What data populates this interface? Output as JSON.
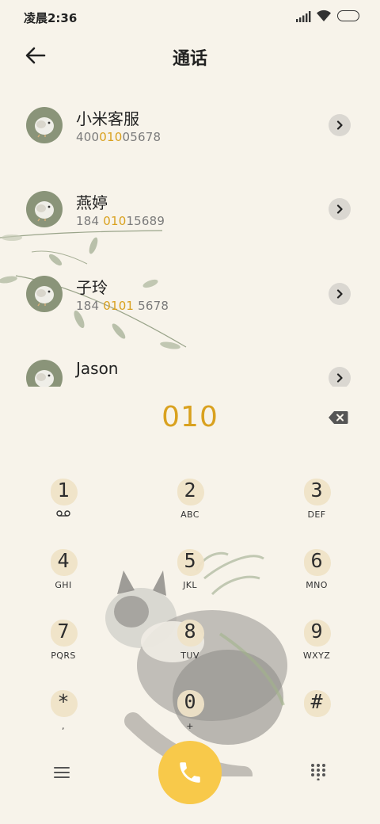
{
  "status": {
    "time": "凌晨2:36"
  },
  "header": {
    "title": "通话"
  },
  "contacts": [
    {
      "name": "小米客服",
      "num_pre": "400",
      "num_hl": "010",
      "num_post": "05678"
    },
    {
      "name": "燕婷",
      "num_pre": "184 ",
      "num_hl": "010",
      "num_post": "15689"
    },
    {
      "name": "子玲",
      "num_pre": "184 ",
      "num_hl": "0101",
      "num_post": " 5678"
    },
    {
      "name": "Jason",
      "num_pre": "",
      "num_hl": "",
      "num_post": ""
    }
  ],
  "input": {
    "digits": "010"
  },
  "keypad": [
    {
      "digit": "1",
      "sub": ""
    },
    {
      "digit": "2",
      "sub": "ABC"
    },
    {
      "digit": "3",
      "sub": "DEF"
    },
    {
      "digit": "4",
      "sub": "GHI"
    },
    {
      "digit": "5",
      "sub": "JKL"
    },
    {
      "digit": "6",
      "sub": "MNO"
    },
    {
      "digit": "7",
      "sub": "PQRS"
    },
    {
      "digit": "8",
      "sub": "TUV"
    },
    {
      "digit": "9",
      "sub": "WXYZ"
    },
    {
      "digit": "*",
      "sub": ","
    },
    {
      "digit": "0",
      "sub": "+"
    },
    {
      "digit": "#",
      "sub": ""
    }
  ],
  "colors": {
    "accent": "#d9a11f",
    "call_button": "#f8c94a",
    "avatar": "#8a9479",
    "background": "#f7f3ea"
  },
  "icons": [
    "signal-icon",
    "wifi-icon",
    "battery-icon",
    "back-arrow-icon",
    "chevron-right-icon",
    "backspace-icon",
    "voicemail-icon",
    "menu-icon",
    "phone-icon",
    "dialpad-icon"
  ]
}
